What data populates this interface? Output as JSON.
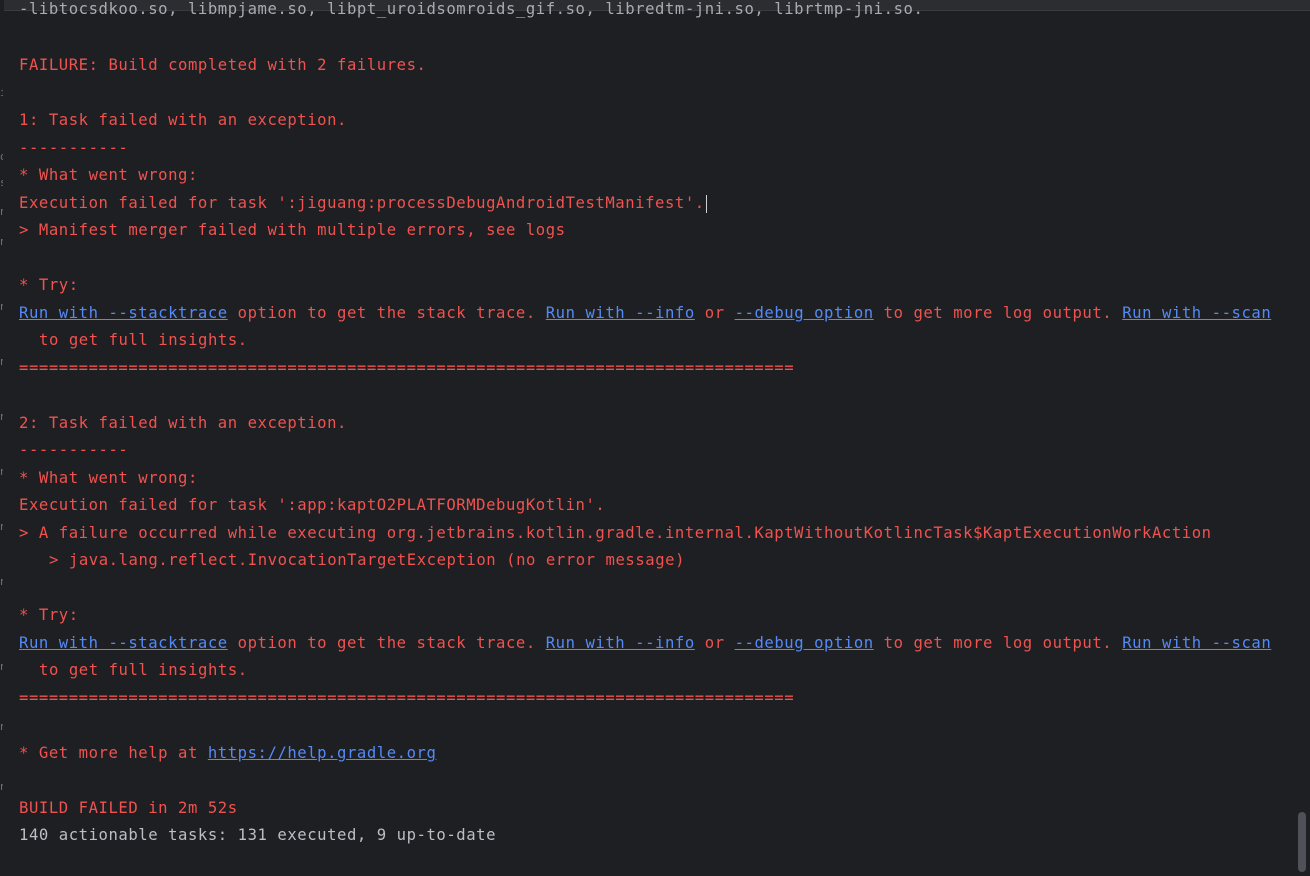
{
  "console": {
    "top_partial": "-libtocsdkoo.so, libmpjame.so, libpt_uroidsomroids_gif.so, libredtm-jni.so, librtmp-jni.so.",
    "failure_summary": "FAILURE: Build completed with 2 failures.",
    "failures": [
      {
        "header": "1: Task failed with an exception.",
        "separator": "-----------",
        "what_went_wrong": "* What went wrong:",
        "execution_line": "Execution failed for task ':jiguang:processDebugAndroidTestManifest'.",
        "details": [
          "> Manifest merger failed with multiple errors, see logs"
        ],
        "try_label": "* Try:",
        "try_links": {
          "stacktrace": "Run with --stacktrace",
          "text1": " option to get the stack trace. ",
          "info": "Run with --info",
          "or": " or ",
          "debug": "--debug option",
          "text2": " to get more log output. ",
          "scan": "Run with --scan",
          "text3": "to get full insights."
        },
        "double_separator": "=============================================================================="
      },
      {
        "header": "2: Task failed with an exception.",
        "separator": "-----------",
        "what_went_wrong": "* What went wrong:",
        "execution_line": "Execution failed for task ':app:kaptO2PLATFORMDebugKotlin'.",
        "details": [
          "> A failure occurred while executing org.jetbrains.kotlin.gradle.internal.KaptWithoutKotlincTask$KaptExecutionWorkAction",
          "> java.lang.reflect.InvocationTargetException (no error message)"
        ],
        "try_label": "* Try:",
        "try_links": {
          "stacktrace": "Run with --stacktrace",
          "text1": " option to get the stack trace. ",
          "info": "Run with --info",
          "or": " or ",
          "debug": "--debug option",
          "text2": " to get more log output. ",
          "scan": "Run with --scan",
          "text3": "to get full insights."
        },
        "double_separator": "=============================================================================="
      }
    ],
    "help_prefix": "* Get more help at ",
    "help_link": "https://help.gradle.org",
    "build_failed": "BUILD FAILED in 2m 52s",
    "tasks_summary": "140 actionable tasks: 131 executed, 9 up-to-date"
  },
  "gutter_marks": [
    "i",
    "o",
    "s",
    "n",
    "n",
    "n",
    "n",
    "n",
    "n",
    "n",
    "n",
    "n",
    "n",
    "n"
  ],
  "colors": {
    "background": "#1e1f22",
    "error_text": "#f0524f",
    "normal_text": "#bcbec4",
    "link": "#548af7"
  }
}
